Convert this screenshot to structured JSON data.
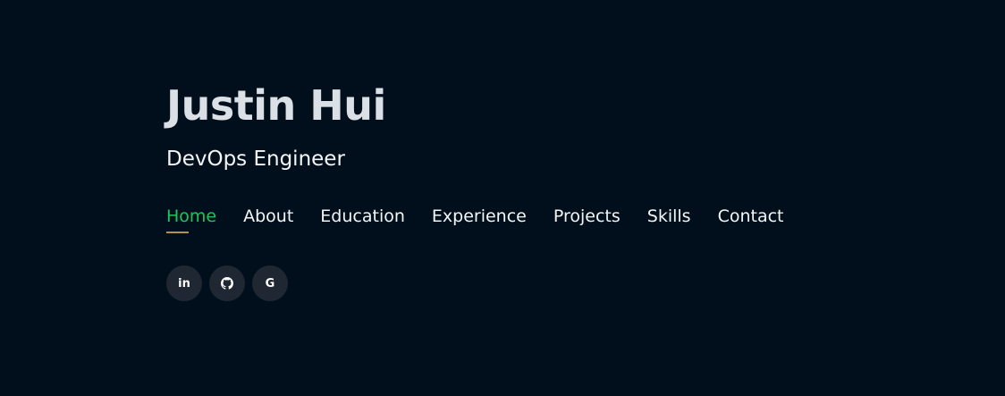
{
  "hero": {
    "name": "Justin Hui",
    "role": "DevOps Engineer"
  },
  "nav": {
    "items": [
      {
        "label": "Home",
        "active": true
      },
      {
        "label": "About"
      },
      {
        "label": "Education"
      },
      {
        "label": "Experience"
      },
      {
        "label": "Projects"
      },
      {
        "label": "Skills"
      },
      {
        "label": "Contact"
      }
    ]
  },
  "socials": {
    "items": [
      {
        "icon": "linkedin-icon",
        "glyph": "in"
      },
      {
        "icon": "github-icon"
      },
      {
        "icon": "google-icon",
        "glyph": "G"
      }
    ]
  },
  "colors": {
    "background": "#010f1c",
    "name": "#dbe0e6",
    "text": "#f3f5f7",
    "active_nav": "#1ec45c",
    "active_underline": "#b09346",
    "social_bg": "#1f2832"
  }
}
